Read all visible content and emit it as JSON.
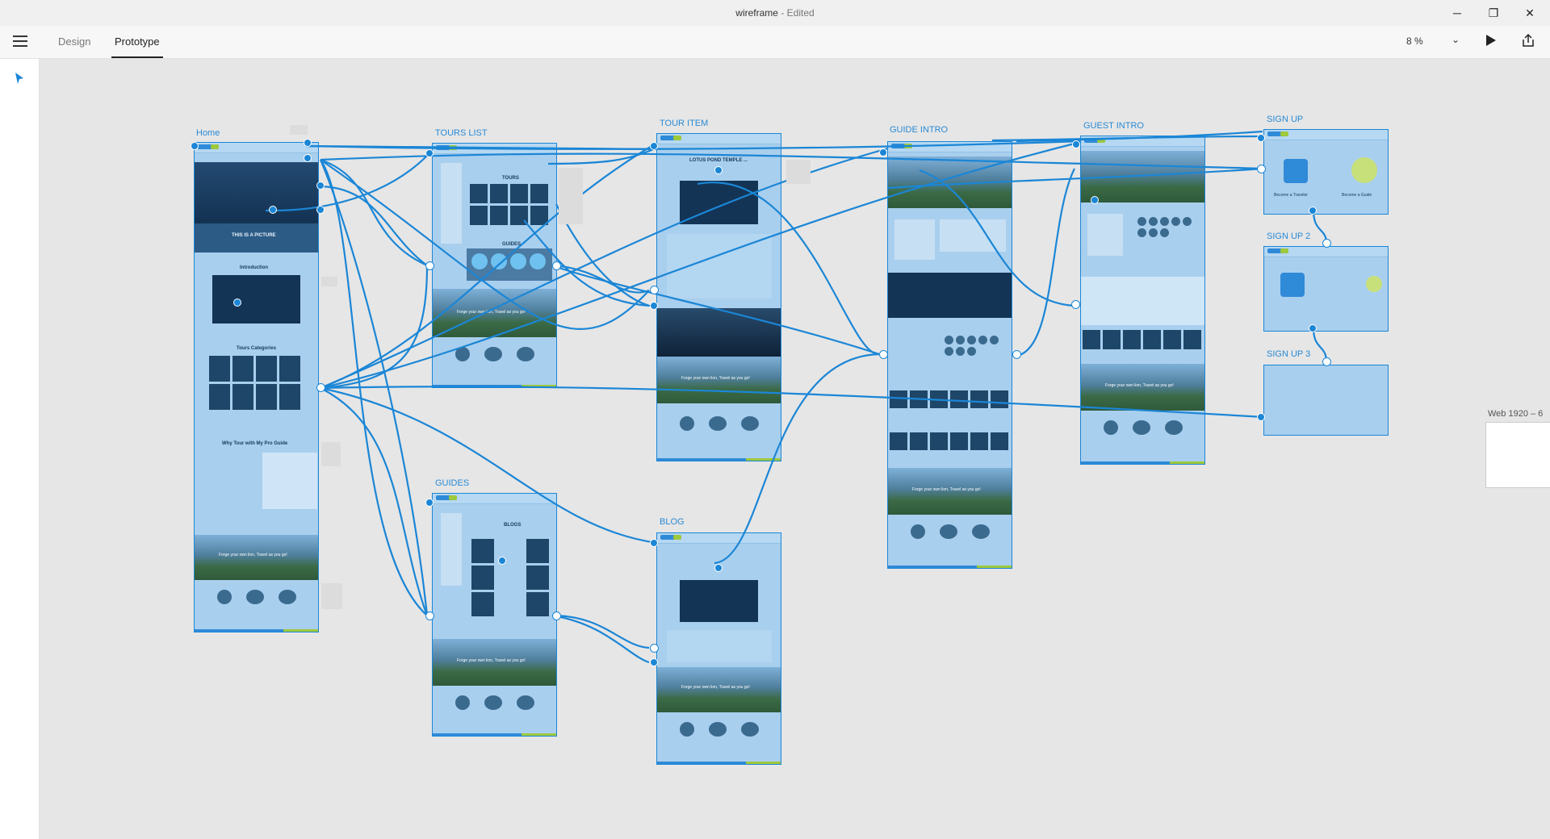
{
  "window": {
    "title": "wireframe",
    "title_suffix": " - Edited",
    "minimize_glyph": "─",
    "restore_glyph": "❐",
    "close_glyph": "✕"
  },
  "toolbar": {
    "tabs": [
      {
        "label": "Design",
        "active": false
      },
      {
        "label": "Prototype",
        "active": true
      }
    ],
    "zoom": "8 %",
    "zoom_chevron": "⌄"
  },
  "artboards": [
    {
      "name": "Home",
      "headline": "THIS IS A PICTURE",
      "section1": "Introduction",
      "section2": "Tours Categories",
      "section3": "Why Tour with My Pro Guide",
      "banner": "Forge your own lion, Travel as you go!"
    },
    {
      "name": "TOURS LIST",
      "section1": "TOURS",
      "section2": "GUIDES",
      "banner": "Forge your own lion, Travel as you go!"
    },
    {
      "name": "TOUR ITEM",
      "headline": "LOTUS POND TEMPLE ...",
      "banner": "Forge your own lion, Travel as you go!"
    },
    {
      "name": "GUIDE INTRO",
      "banner": "Forge your own lion, Travel as you go!"
    },
    {
      "name": "GUEST INTRO",
      "banner": "Forge your own lion, Travel as you go!"
    },
    {
      "name": "SIGN UP",
      "left_caption": "Become a Traveler",
      "right_caption": "Become a Guide"
    },
    {
      "name": "SIGN UP 2"
    },
    {
      "name": "SIGN UP 3"
    },
    {
      "name": "GUIDES",
      "section1": "BLOGS",
      "banner": "Forge your own lion, Travel as you go!"
    },
    {
      "name": "BLOG",
      "banner": "Forge your own lion, Travel as you go!"
    }
  ],
  "extra_artboard": {
    "name": "Web 1920 – 6"
  },
  "colors": {
    "accent": "#1b86d6",
    "artboard_fill": "#a9cfee",
    "footer_green": "#9fc93c",
    "canvas": "#e6e6e6"
  },
  "icons": {
    "menu": "hamburger-icon",
    "select": "select-arrow-icon",
    "play": "play-icon",
    "share": "share-icon"
  }
}
